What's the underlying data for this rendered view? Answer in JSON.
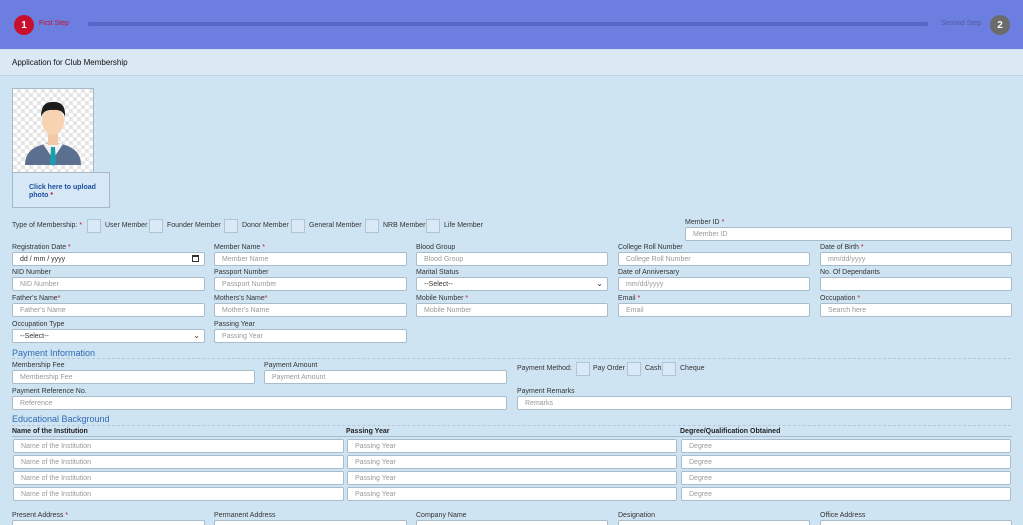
{
  "stepper": {
    "step1_number": "1",
    "step1_label": "First Step",
    "step2_number": "2",
    "step2_label": "Second Step"
  },
  "header": {
    "title": "Application for Club Membership"
  },
  "photo": {
    "upload_text": "Click here to upload photo",
    "required": "*"
  },
  "membership_type": {
    "label": "Type of Membership:",
    "required": "*",
    "options": [
      "User Member",
      "Founder Member",
      "Donor Member",
      "General Member",
      "NRB Member",
      "Life Member"
    ]
  },
  "member_id": {
    "label": "Member ID",
    "required": "*",
    "placeholder": "Member ID"
  },
  "row1": {
    "registration_date": {
      "label": "Registration Date",
      "required": "*",
      "value": "dd / mm / yyyy"
    },
    "member_name": {
      "label": "Member Name",
      "required": "*",
      "placeholder": "Member Name"
    },
    "blood_group": {
      "label": "Blood Group",
      "placeholder": "Blood Group"
    },
    "college_roll": {
      "label": "College Roll Number",
      "placeholder": "College Roll Number"
    },
    "date_of_birth": {
      "label": "Date of Birth",
      "required": "*",
      "placeholder": "mm/dd/yyyy"
    }
  },
  "row2": {
    "nid": {
      "label": "NID Number",
      "placeholder": "NID Number"
    },
    "passport": {
      "label": "Passport Number",
      "placeholder": "Passport Number"
    },
    "marital_status": {
      "label": "Marital Status",
      "selected": "--Select--"
    },
    "anniversary": {
      "label": "Date of Anniversary",
      "placeholder": "mm/dd/yyyy"
    },
    "dependants": {
      "label": "No. Of Dependants",
      "placeholder": ""
    }
  },
  "row3": {
    "father": {
      "label": "Father's Name",
      "required": "*",
      "placeholder": "Father's Name"
    },
    "mother": {
      "label": "Mothers's Name",
      "required": "*",
      "placeholder": "Mother's Name"
    },
    "mobile": {
      "label": "Mobile Number",
      "required": "*",
      "placeholder": "Mobile Number"
    },
    "email": {
      "label": "Email",
      "required": "*",
      "placeholder": "Email"
    },
    "occupation": {
      "label": "Occupation",
      "required": "*",
      "placeholder": "Search here"
    }
  },
  "row4": {
    "occupation_type": {
      "label": "Occupation Type",
      "selected": "--Select--"
    },
    "passing_year": {
      "label": "Passing Year",
      "placeholder": "Passing Year"
    }
  },
  "payment": {
    "title": "Payment Information",
    "fee": {
      "label": "Membership Fee",
      "placeholder": "Membership Fee"
    },
    "amount": {
      "label": "Payment Amount",
      "placeholder": "Payment Amount"
    },
    "method_label": "Payment Method:",
    "methods": [
      "Pay Order",
      "Cash",
      "Cheque"
    ],
    "reference": {
      "label": "Payment Reference No.",
      "placeholder": "Reference"
    },
    "remarks": {
      "label": "Payment Remarks",
      "placeholder": "Remarks"
    }
  },
  "education": {
    "title": "Educational Background",
    "columns": [
      "Name of the Institution",
      "Passing Year",
      "Degree/Qualification Obtained"
    ],
    "placeholders": [
      "Name of the Institution",
      "Passing Year",
      "Degree"
    ]
  },
  "bottom_row": {
    "present_address": {
      "label": "Present Address",
      "required": "*"
    },
    "permanent_address": {
      "label": "Permanent Address"
    },
    "company_name": {
      "label": "Company Name"
    },
    "designation": {
      "label": "Designation"
    },
    "office_address": {
      "label": "Office Address"
    }
  }
}
